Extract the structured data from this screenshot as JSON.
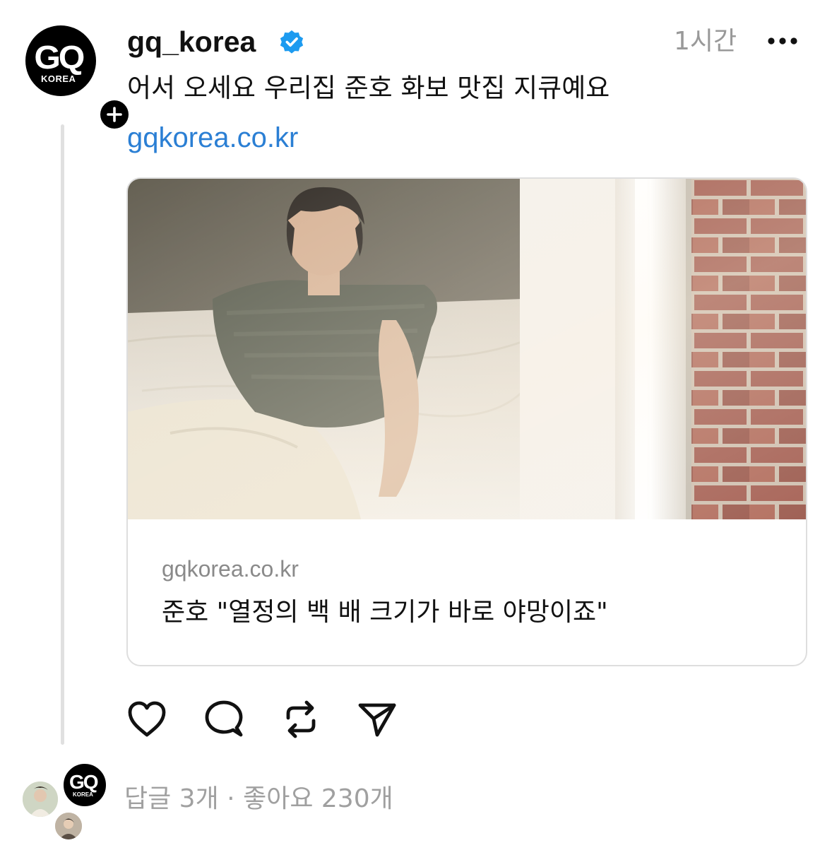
{
  "post": {
    "author": {
      "username": "gq_korea",
      "avatar_logo_main": "GQ",
      "avatar_logo_sub": "KOREA",
      "verified": true
    },
    "timestamp": "1시간",
    "caption": "어서 오세요 우리집 준호 화보 맛집 지큐예요",
    "link_text": "gqkorea.co.kr",
    "link_card": {
      "domain": "gqkorea.co.kr",
      "title": "준호 \"열정의 백 배 크기가 바로 야망이죠\""
    },
    "actions": [
      "heart-icon",
      "comment-icon",
      "repost-icon",
      "share-icon"
    ]
  },
  "footer": {
    "replies_label": "답글 3개",
    "separator": "·",
    "likes_label": "좋아요 230개",
    "replier_logo_main": "GQ",
    "replier_logo_sub": "KOREA"
  },
  "colors": {
    "link": "#2b7fd4",
    "verified": "#1d9bf0",
    "muted": "#999999"
  }
}
